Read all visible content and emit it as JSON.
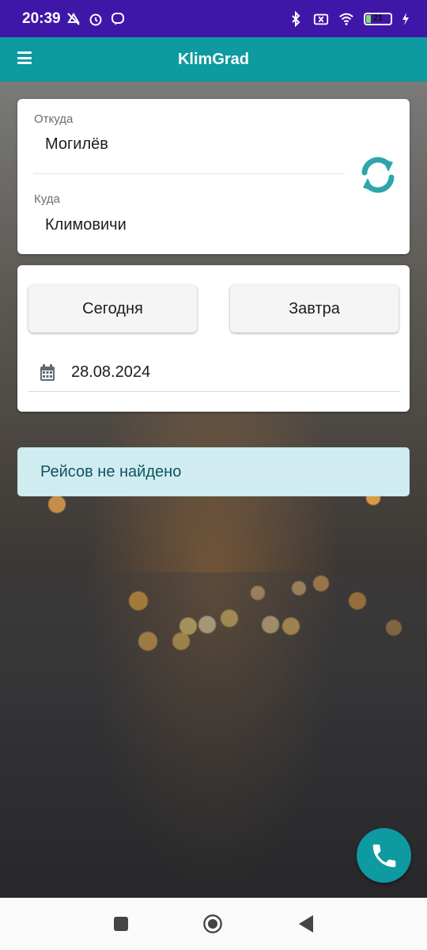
{
  "status_bar": {
    "time": "20:39",
    "battery_level": "21",
    "icons": [
      "mute-vibrate-icon",
      "alarm-icon",
      "viber-icon",
      "bluetooth-icon",
      "sim-off-icon",
      "wifi-icon",
      "battery-icon",
      "charging-icon"
    ]
  },
  "app_bar": {
    "title": "KlimGrad",
    "menu_icon": "hamburger-menu-icon"
  },
  "route": {
    "from_label": "Откуда",
    "from_value": "Могилёв",
    "to_label": "Куда",
    "to_value": "Климовичи",
    "swap_icon": "swap-sync-icon"
  },
  "date": {
    "today_label": "Сегодня",
    "tomorrow_label": "Завтра",
    "selected_date": "28.08.2024",
    "calendar_icon": "calendar-icon"
  },
  "results": {
    "message": "Рейсов не найдено"
  },
  "fab": {
    "icon": "phone-icon"
  },
  "nav_bar": {
    "icons": [
      "recents-square-icon",
      "home-circle-icon",
      "back-triangle-icon"
    ]
  },
  "colors": {
    "status_bar": "#3f17a8",
    "primary": "#0d9aa0",
    "alert_bg": "#d1ecf1",
    "alert_text": "#0c5460"
  }
}
